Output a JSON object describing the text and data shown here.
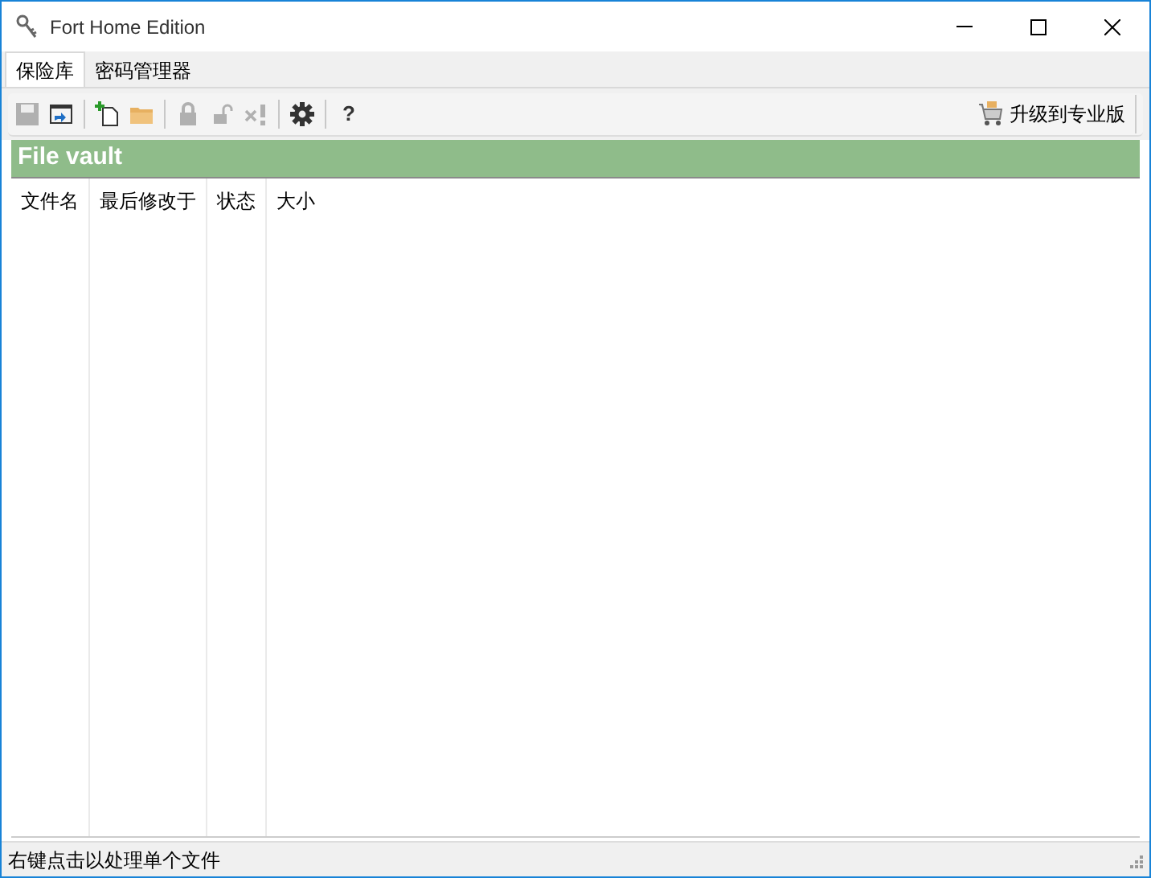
{
  "window": {
    "title": "Fort Home Edition"
  },
  "tabs": [
    {
      "label": "保险库",
      "selected": true
    },
    {
      "label": "密码管理器",
      "selected": false
    }
  ],
  "toolbar": [
    {
      "kind": "save",
      "disabled": true
    },
    {
      "kind": "window",
      "disabled": false
    },
    {
      "kind": "sep"
    },
    {
      "kind": "new",
      "disabled": false
    },
    {
      "kind": "folder",
      "disabled": false
    },
    {
      "kind": "sep"
    },
    {
      "kind": "lock",
      "disabled": true
    },
    {
      "kind": "unlock",
      "disabled": true
    },
    {
      "kind": "delete",
      "disabled": true
    },
    {
      "kind": "sep"
    },
    {
      "kind": "gear",
      "disabled": false
    },
    {
      "kind": "sep"
    },
    {
      "kind": "help",
      "label": "?",
      "disabled": false
    }
  ],
  "upgrade_button": {
    "label": "升级到专业版"
  },
  "panel": {
    "title": "File vault"
  },
  "table": {
    "columns": [
      "文件名",
      "最后修改于",
      "状态",
      "大小"
    ]
  },
  "status_bar": {
    "text": "右键点击以处理单个文件"
  }
}
